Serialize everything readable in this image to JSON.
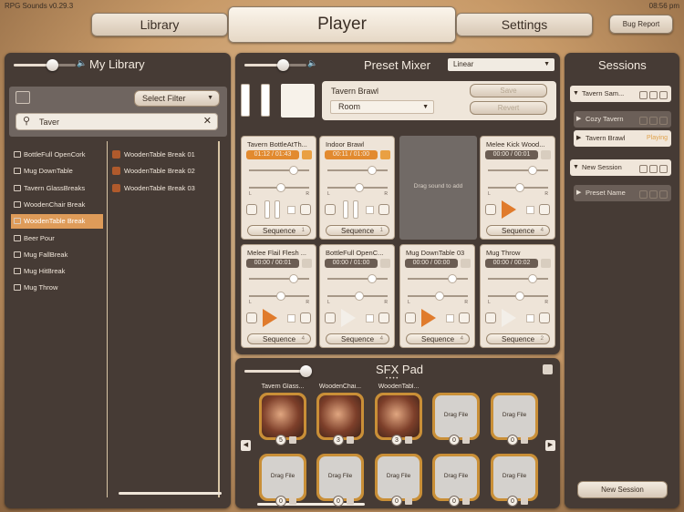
{
  "status": {
    "version": "RPG Sounds v0.29.3",
    "time": "08:56 pm"
  },
  "tabs": {
    "library": "Library",
    "player": "Player",
    "settings": "Settings",
    "bug_report": "Bug Report"
  },
  "library": {
    "title": "My Library",
    "filter_label": "Select Filter",
    "search_value": "Taver",
    "items": [
      "BottleFull OpenCork",
      "Mug DownTable",
      "Tavern GlassBreaks",
      "WoodenChair Break",
      "WoodenTable Break",
      "Beer Pour",
      "Mug FallBreak",
      "Mug HitBreak",
      "Mug Throw"
    ],
    "selected_index": 4,
    "subitems": [
      "WoodenTable Break 01",
      "WoodenTable Break 02",
      "WoodenTable Break 03"
    ]
  },
  "mixer": {
    "title": "Preset Mixer",
    "mode": "Linear",
    "preset_name": "Tavern Brawl",
    "preset_type": "Room",
    "save": "Save",
    "revert": "Revert",
    "drag_hint": "Drag sound to add",
    "cards": [
      {
        "name": "Tavern BottleAtTh...",
        "time": "01:12 / 01:43",
        "active": true,
        "seq": "Sequence",
        "n": "1",
        "playing": false
      },
      {
        "name": "Indoor Brawl",
        "time": "00:11 / 01:00",
        "active": true,
        "seq": "Sequence",
        "n": "1",
        "playing": false
      },
      {
        "name": "Melee Kick Wood...",
        "time": "00:00 / 00:01",
        "active": false,
        "seq": "Sequence",
        "n": "4",
        "playing": true
      },
      {
        "name": "Melee Flail Flesh ...",
        "time": "00:00 / 00:01",
        "active": false,
        "seq": "Sequence",
        "n": "4",
        "playing": true
      },
      {
        "name": "BottleFull OpenC...",
        "time": "00:00 / 01:00",
        "active": false,
        "seq": "Sequence",
        "n": "4",
        "playing": false
      },
      {
        "name": "Mug DownTable 03",
        "time": "00:00 / 00:00",
        "active": false,
        "seq": "Sequence",
        "n": "4",
        "playing": true
      },
      {
        "name": "Mug Throw",
        "time": "00:00 / 00:02",
        "active": false,
        "seq": "Sequence",
        "n": "2",
        "playing": false
      }
    ],
    "lr_left": "L",
    "lr_right": "R"
  },
  "sfx": {
    "title": "SFX Pad",
    "pads": [
      {
        "name": "Tavern Glass...",
        "label": "",
        "count": "5"
      },
      {
        "name": "WoodenChai...",
        "label": "",
        "count": "3"
      },
      {
        "name": "WoodenTabl...",
        "label": "",
        "count": "3"
      },
      {
        "name": "",
        "label": "Drag File",
        "count": "0"
      },
      {
        "name": "",
        "label": "Drag File",
        "count": "0"
      },
      {
        "name": "",
        "label": "Drag File",
        "count": "0"
      },
      {
        "name": "",
        "label": "Drag File",
        "count": "0"
      },
      {
        "name": "",
        "label": "Drag File",
        "count": "0"
      },
      {
        "name": "",
        "label": "Drag File",
        "count": "0"
      },
      {
        "name": "",
        "label": "Drag File",
        "count": "0"
      }
    ]
  },
  "sessions": {
    "title": "Sessions",
    "new_session_button": "New Session",
    "items": [
      {
        "label": "Tavern Sam...",
        "type": "header"
      },
      {
        "label": "Cozy Tavern",
        "type": "preset"
      },
      {
        "label": "Tavern Brawl",
        "type": "preset-active",
        "status": "Playing"
      },
      {
        "label": "New Session",
        "type": "header"
      },
      {
        "label": "Preset Name",
        "type": "preset"
      }
    ]
  }
}
